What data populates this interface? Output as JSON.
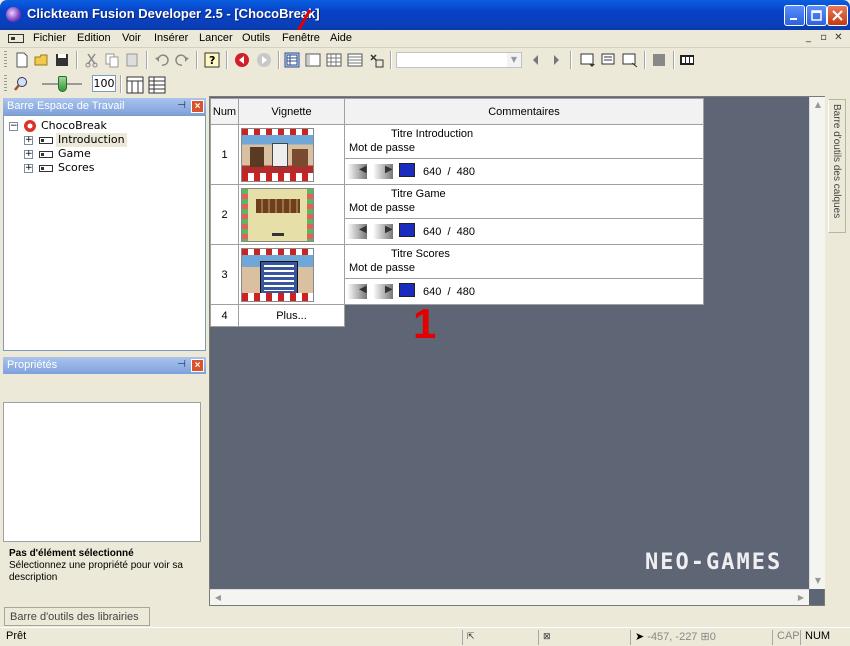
{
  "window": {
    "title": "Clickteam Fusion Developer 2.5 - [ChocoBreak]"
  },
  "menu": [
    "Fichier",
    "Edition",
    "Voir",
    "Insérer",
    "Lancer",
    "Outils",
    "Fenêtre",
    "Aide"
  ],
  "toolbar": {
    "zoom_value": "100"
  },
  "workspace": {
    "header": "Barre Espace de Travail",
    "app_name": "ChocoBreak",
    "frames": [
      "Introduction",
      "Game",
      "Scores"
    ]
  },
  "properties": {
    "header": "Propriétés",
    "desc_title": "Pas d'élément sélectionné",
    "desc_text": "Sélectionnez une propriété pour voir sa description"
  },
  "storyboard": {
    "col_num": "Num",
    "col_thumb": "Vignette",
    "col_comments": "Commentaires",
    "rows": [
      {
        "num": "1",
        "title": "Titre Introduction",
        "password": "Mot de passe",
        "width": "640",
        "height": "480"
      },
      {
        "num": "2",
        "title": "Titre Game",
        "password": "Mot de passe",
        "width": "640",
        "height": "480"
      },
      {
        "num": "3",
        "title": "Titre Scores",
        "password": "Mot de passe",
        "width": "640",
        "height": "480"
      }
    ],
    "add_num": "4",
    "add_label": "Plus..."
  },
  "annotation": {
    "number": "1"
  },
  "watermark": "NEO-GAMES",
  "right_tab": "Barre d'outils des calques",
  "bottom_tab": "Barre d'outils des librairies",
  "status": {
    "ready": "Prêt",
    "coords": "-457, -227",
    "count": "0",
    "cap": "CAP",
    "num": "NUM"
  },
  "colors": {
    "editor_bg": "#5e6575",
    "annotation": "#e30000",
    "title_bar": "#0840c8"
  }
}
